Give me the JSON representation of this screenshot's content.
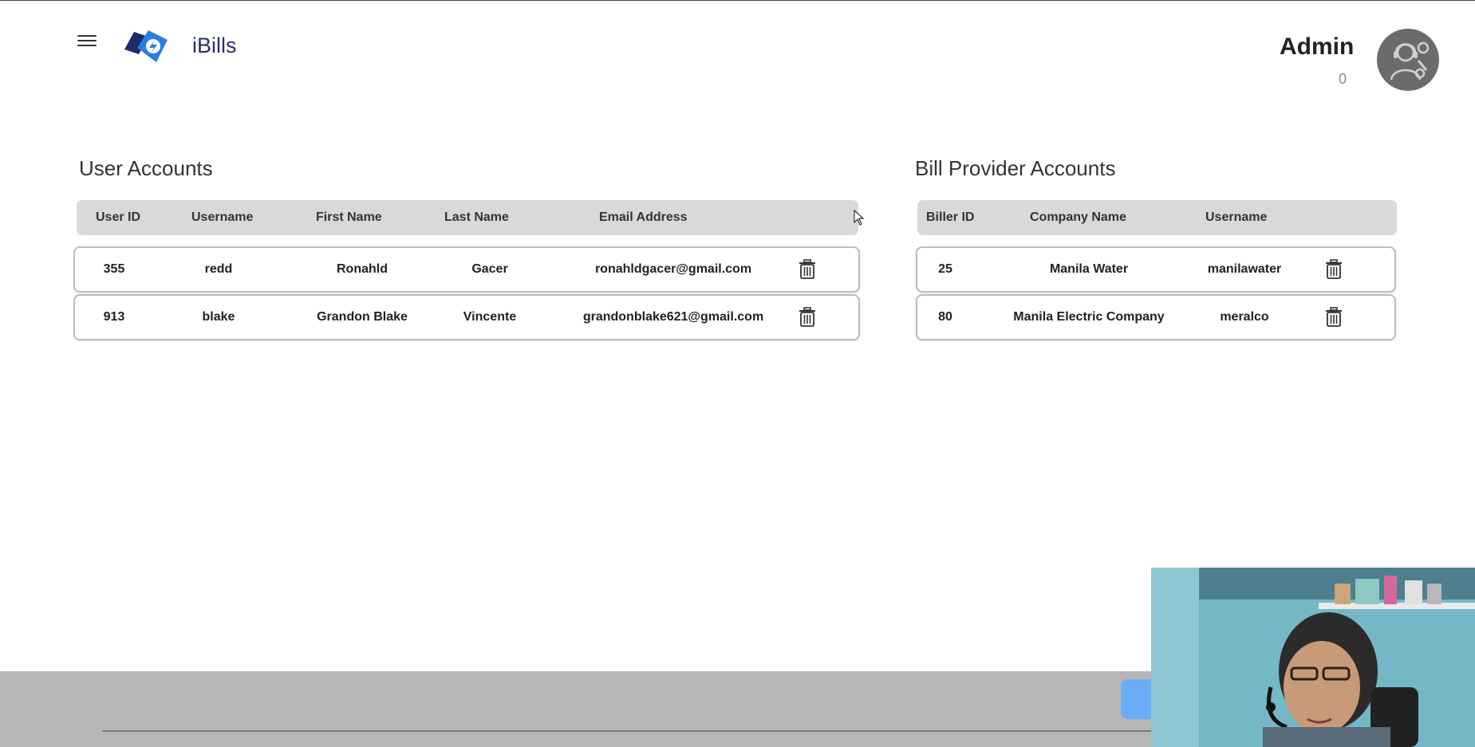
{
  "header": {
    "brand": "iBills",
    "admin_name": "Admin",
    "admin_count": "0"
  },
  "users": {
    "title": "User Accounts",
    "columns": [
      "User ID",
      "Username",
      "First Name",
      "Last Name",
      "Email Address"
    ],
    "rows": [
      [
        "355",
        "redd",
        "Ronahld",
        "Gacer",
        "ronahldgacer@gmail.com"
      ],
      [
        "913",
        "blake",
        "Grandon Blake",
        "Vincente",
        "grandonblake621@gmail.com"
      ]
    ]
  },
  "billers": {
    "title": "Bill Provider Accounts",
    "columns": [
      "Biller ID",
      "Company Name",
      "Username"
    ],
    "rows": [
      [
        "25",
        "Manila Water",
        "manilawater"
      ],
      [
        "80",
        "Manila Electric Company",
        "meralco"
      ]
    ]
  },
  "colors": {
    "brand": "#2b2d6e",
    "header_bg": "#d9d9d9",
    "footer_bg": "#b6b6b6",
    "accent": "#6aaef8"
  },
  "icons": [
    "menu-icon",
    "logo-icon",
    "admin-avatar-icon",
    "trash-icon"
  ]
}
